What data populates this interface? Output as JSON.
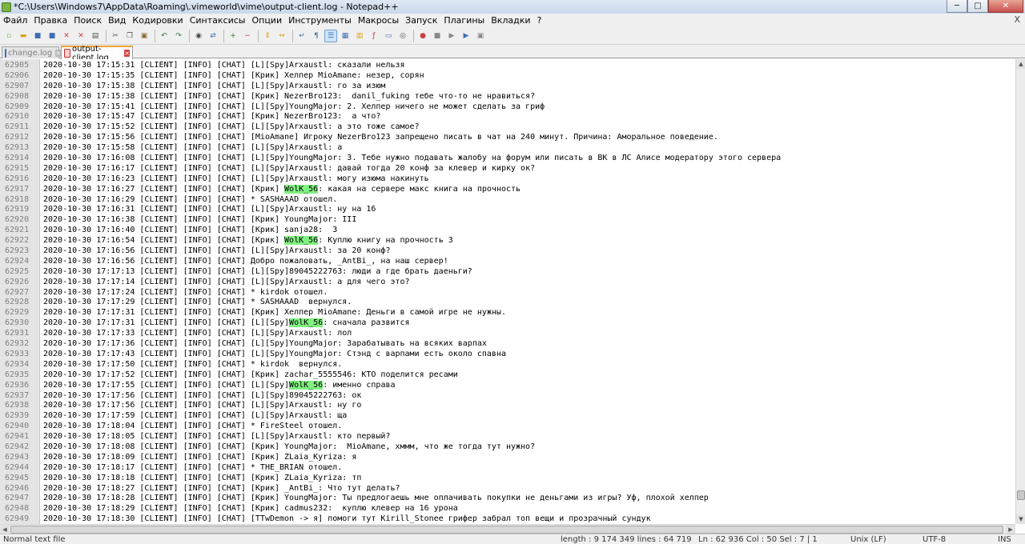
{
  "window": {
    "title": "*C:\\Users\\Windows7\\AppData\\Roaming\\.vimeworld\\vime\\output-client.log - Notepad++",
    "minimize_label": "─",
    "maximize_label": "□",
    "close_label": "✕"
  },
  "menu": {
    "items": [
      "Файл",
      "Правка",
      "Поиск",
      "Вид",
      "Кодировки",
      "Синтаксисы",
      "Опции",
      "Инструменты",
      "Макросы",
      "Запуск",
      "Плагины",
      "Вкладки",
      "?"
    ],
    "close_label": "X"
  },
  "tabs": [
    {
      "label": "change.log",
      "active": false
    },
    {
      "label": "output-client.log",
      "active": true
    }
  ],
  "highlight_color": "#80f080",
  "editor": {
    "lines": [
      {
        "n": "62905",
        "t": "2020-10-30 17:15:31 [CLIENT] [INFO] [CHAT] [L][Spy]Arxaustl: сказали нельзя"
      },
      {
        "n": "62906",
        "t": "2020-10-30 17:15:35 [CLIENT] [INFO] [CHAT] [Крик] Хелпер MioAmane: незер, сорян"
      },
      {
        "n": "62907",
        "t": "2020-10-30 17:15:38 [CLIENT] [INFO] [CHAT] [L][Spy]Arxaustl: го за изюм"
      },
      {
        "n": "62908",
        "t": "2020-10-30 17:15:38 [CLIENT] [INFO] [CHAT] [Крик] NezerBro123:  danil_fuking тебе что-то не нравиться?"
      },
      {
        "n": "62909",
        "t": "2020-10-30 17:15:41 [CLIENT] [INFO] [CHAT] [L][Spy]YoungMajor: 2. Хелпер ничего не может сделать за гриф"
      },
      {
        "n": "62910",
        "t": "2020-10-30 17:15:47 [CLIENT] [INFO] [CHAT] [Крик] NezerBro123:  а что?"
      },
      {
        "n": "62911",
        "t": "2020-10-30 17:15:52 [CLIENT] [INFO] [CHAT] [L][Spy]Arxaustl: а это тоже самое?"
      },
      {
        "n": "62912",
        "t": "2020-10-30 17:15:56 [CLIENT] [INFO] [CHAT] [MioAmane] Игроку NezerBro123 запрещено писать в чат на 240 минут. Причина: Аморальное поведение."
      },
      {
        "n": "62913",
        "t": "2020-10-30 17:15:58 [CLIENT] [INFO] [CHAT] [L][Spy]Arxaustl: а"
      },
      {
        "n": "62914",
        "t": "2020-10-30 17:16:08 [CLIENT] [INFO] [CHAT] [L][Spy]YoungMajor: 3. Тебе нужно подавать жалобу на форум или писать в ВК в ЛС Алисе модератору этого сервера"
      },
      {
        "n": "62915",
        "t": "2020-10-30 17:16:17 [CLIENT] [INFO] [CHAT] [L][Spy]Arxaustl: давай тогда 20 конф за клевер и кирку ок?"
      },
      {
        "n": "62916",
        "t": "2020-10-30 17:16:23 [CLIENT] [INFO] [CHAT] [L][Spy]Arxaustl: могу изюма накинуть"
      },
      {
        "n": "62917",
        "t": "2020-10-30 17:16:27 [CLIENT] [INFO] [CHAT] [Крик] WolK_56: какая на сервере макс книга на прочность"
      },
      {
        "n": "62918",
        "t": "2020-10-30 17:16:29 [CLIENT] [INFO] [CHAT] * SASHAAAD отошел."
      },
      {
        "n": "62919",
        "t": "2020-10-30 17:16:31 [CLIENT] [INFO] [CHAT] [L][Spy]Arxaustl: ну на 16"
      },
      {
        "n": "62920",
        "t": "2020-10-30 17:16:38 [CLIENT] [INFO] [CHAT] [Крик] YoungMajor: III"
      },
      {
        "n": "62921",
        "t": "2020-10-30 17:16:40 [CLIENT] [INFO] [CHAT] [Крик] sanja28:  3"
      },
      {
        "n": "62922",
        "t": "2020-10-30 17:16:54 [CLIENT] [INFO] [CHAT] [Крик] WolK_56: Куплю книгу на прочность 3"
      },
      {
        "n": "62923",
        "t": "2020-10-30 17:16:56 [CLIENT] [INFO] [CHAT] [L][Spy]Arxaustl: за 20 конф?"
      },
      {
        "n": "62924",
        "t": "2020-10-30 17:16:56 [CLIENT] [INFO] [CHAT] Добро пожаловать, _AntBi_, на наш сервер!"
      },
      {
        "n": "62925",
        "t": "2020-10-30 17:17:13 [CLIENT] [INFO] [CHAT] [L][Spy]89045222763: люди а где брать даеньги?"
      },
      {
        "n": "62926",
        "t": "2020-10-30 17:17:14 [CLIENT] [INFO] [CHAT] [L][Spy]Arxaustl: а для чего это?"
      },
      {
        "n": "62927",
        "t": "2020-10-30 17:17:24 [CLIENT] [INFO] [CHAT] * kirdok отошел."
      },
      {
        "n": "62928",
        "t": "2020-10-30 17:17:29 [CLIENT] [INFO] [CHAT] * SASHAAAD  вернулся."
      },
      {
        "n": "62929",
        "t": "2020-10-30 17:17:31 [CLIENT] [INFO] [CHAT] [Крик] Хелпер MioAmane: Деньги в самой игре не нужны."
      },
      {
        "n": "62930",
        "t": "2020-10-30 17:17:31 [CLIENT] [INFO] [CHAT] [L][Spy]WolK_56: сначала развится"
      },
      {
        "n": "62931",
        "t": "2020-10-30 17:17:33 [CLIENT] [INFO] [CHAT] [L][Spy]Arxaustl: лол"
      },
      {
        "n": "62932",
        "t": "2020-10-30 17:17:36 [CLIENT] [INFO] [CHAT] [L][Spy]YoungMajor: Зарабатывать на всяких варпах"
      },
      {
        "n": "62933",
        "t": "2020-10-30 17:17:43 [CLIENT] [INFO] [CHAT] [L][Spy]YoungMajor: Стэнд с варпами есть около спавна"
      },
      {
        "n": "62934",
        "t": "2020-10-30 17:17:50 [CLIENT] [INFO] [CHAT] * kirdok  вернулся."
      },
      {
        "n": "62935",
        "t": "2020-10-30 17:17:52 [CLIENT] [INFO] [CHAT] [Крик] zachar_5555546: КТО поделится ресами"
      },
      {
        "n": "62936",
        "t": "2020-10-30 17:17:55 [CLIENT] [INFO] [CHAT] [L][Spy]WolK_56: именно справа"
      },
      {
        "n": "62937",
        "t": "2020-10-30 17:17:56 [CLIENT] [INFO] [CHAT] [L][Spy]89045222763: ок"
      },
      {
        "n": "62938",
        "t": "2020-10-30 17:17:56 [CLIENT] [INFO] [CHAT] [L][Spy]Arxaustl: ну го"
      },
      {
        "n": "62939",
        "t": "2020-10-30 17:17:59 [CLIENT] [INFO] [CHAT] [L][Spy]Arxaustl: ща"
      },
      {
        "n": "62940",
        "t": "2020-10-30 17:18:04 [CLIENT] [INFO] [CHAT] * FireSteel отошел."
      },
      {
        "n": "62941",
        "t": "2020-10-30 17:18:05 [CLIENT] [INFO] [CHAT] [L][Spy]Arxaustl: кто первый?"
      },
      {
        "n": "62942",
        "t": "2020-10-30 17:18:08 [CLIENT] [INFO] [CHAT] [Крик] YoungMajor:  MioAmane, хммм, что же тогда тут нужно?"
      },
      {
        "n": "62943",
        "t": "2020-10-30 17:18:09 [CLIENT] [INFO] [CHAT] [Крик] ZLaia_Kyriza: я"
      },
      {
        "n": "62944",
        "t": "2020-10-30 17:18:17 [CLIENT] [INFO] [CHAT] * THE_BRIAN отошел."
      },
      {
        "n": "62945",
        "t": "2020-10-30 17:18:18 [CLIENT] [INFO] [CHAT] [Крик] ZLaia_Kyriza: тп"
      },
      {
        "n": "62946",
        "t": "2020-10-30 17:18:27 [CLIENT] [INFO] [CHAT] [Крик] _AntBi_: Что тут делать?"
      },
      {
        "n": "62947",
        "t": "2020-10-30 17:18:28 [CLIENT] [INFO] [CHAT] [Крик] YoungMajor: Ты предлогаешь мне оплачивать покупки не деньгами из игры? Уф, плохой хелпер"
      },
      {
        "n": "62948",
        "t": "2020-10-30 17:18:29 [CLIENT] [INFO] [CHAT] [Крик] cadmus232:  куплю клевер на 16 урона"
      },
      {
        "n": "62949",
        "t": "2020-10-30 17:18:30 [CLIENT] [INFO] [CHAT] [TTwDemon -> я] помоги тут Kirill_Stonee грифер забрал топ вещи и прозрачный сундук"
      }
    ]
  },
  "toolbar": {
    "buttons": [
      {
        "name": "new-file-icon",
        "glyph": "▫",
        "color": "#6aa84f"
      },
      {
        "name": "open-file-icon",
        "glyph": "▬",
        "color": "#d9a21b"
      },
      {
        "name": "save-icon",
        "glyph": "■",
        "color": "#3d6fb5"
      },
      {
        "name": "save-all-icon",
        "glyph": "■",
        "color": "#3d6fb5"
      },
      {
        "name": "close-icon",
        "glyph": "✕",
        "color": "#c94040"
      },
      {
        "name": "close-all-icon",
        "glyph": "✕",
        "color": "#c94040"
      },
      {
        "name": "print-icon",
        "glyph": "▤",
        "color": "#555555"
      },
      {
        "sep": true
      },
      {
        "name": "cut-icon",
        "glyph": "✂",
        "color": "#555555"
      },
      {
        "name": "copy-icon",
        "glyph": "❐",
        "color": "#555555"
      },
      {
        "name": "paste-icon",
        "glyph": "▣",
        "color": "#8a6a30"
      },
      {
        "sep": true
      },
      {
        "name": "undo-icon",
        "glyph": "↶",
        "color": "#2e7d32"
      },
      {
        "name": "redo-icon",
        "glyph": "↷",
        "color": "#2e7d32"
      },
      {
        "sep": true
      },
      {
        "name": "find-icon",
        "glyph": "◉",
        "color": "#444444"
      },
      {
        "name": "replace-icon",
        "glyph": "⇄",
        "color": "#3d6fb5"
      },
      {
        "sep": true
      },
      {
        "name": "zoom-in-icon",
        "glyph": "+",
        "color": "#2e7d32"
      },
      {
        "name": "zoom-out-icon",
        "glyph": "−",
        "color": "#c94040"
      },
      {
        "sep": true
      },
      {
        "name": "sync-vertical-icon",
        "glyph": "⇕",
        "color": "#d9a21b"
      },
      {
        "name": "sync-horizontal-icon",
        "glyph": "⇔",
        "color": "#d9a21b"
      },
      {
        "sep": true
      },
      {
        "name": "word-wrap-icon",
        "glyph": "↵",
        "color": "#3d6fb5"
      },
      {
        "name": "show-all-chars-icon",
        "glyph": "¶",
        "color": "#3d6fb5"
      },
      {
        "name": "indent-guide-icon",
        "glyph": "☰",
        "color": "#3d6fb5",
        "active": true
      },
      {
        "name": "user-language-icon",
        "glyph": "▦",
        "color": "#3d6fb5"
      },
      {
        "name": "doc-map-icon",
        "glyph": "▥",
        "color": "#d9a21b"
      },
      {
        "name": "function-list-icon",
        "glyph": "ƒ",
        "color": "#c94040"
      },
      {
        "name": "folder-workspace-icon",
        "glyph": "▭",
        "color": "#3d6fb5"
      },
      {
        "name": "monitoring-icon",
        "glyph": "◎",
        "color": "#555555"
      },
      {
        "sep": true
      },
      {
        "name": "record-macro-icon",
        "glyph": "●",
        "color": "#c94040"
      },
      {
        "name": "stop-record-icon",
        "glyph": "■",
        "color": "#888888"
      },
      {
        "name": "play-macro-icon",
        "glyph": "▶",
        "color": "#888888"
      },
      {
        "name": "run-macro-multiple-icon",
        "glyph": "▶",
        "color": "#3d6fb5"
      },
      {
        "name": "save-macro-icon",
        "glyph": "▣",
        "color": "#888888"
      }
    ]
  },
  "status": {
    "filetype": "Normal text file",
    "length": "length : 9 174 349    lines : 64 719",
    "position": "Ln : 62 936    Col : 50    Sel : 7 | 1",
    "eol": "Unix (LF)",
    "encoding": "UTF-8",
    "mode": "INS"
  }
}
